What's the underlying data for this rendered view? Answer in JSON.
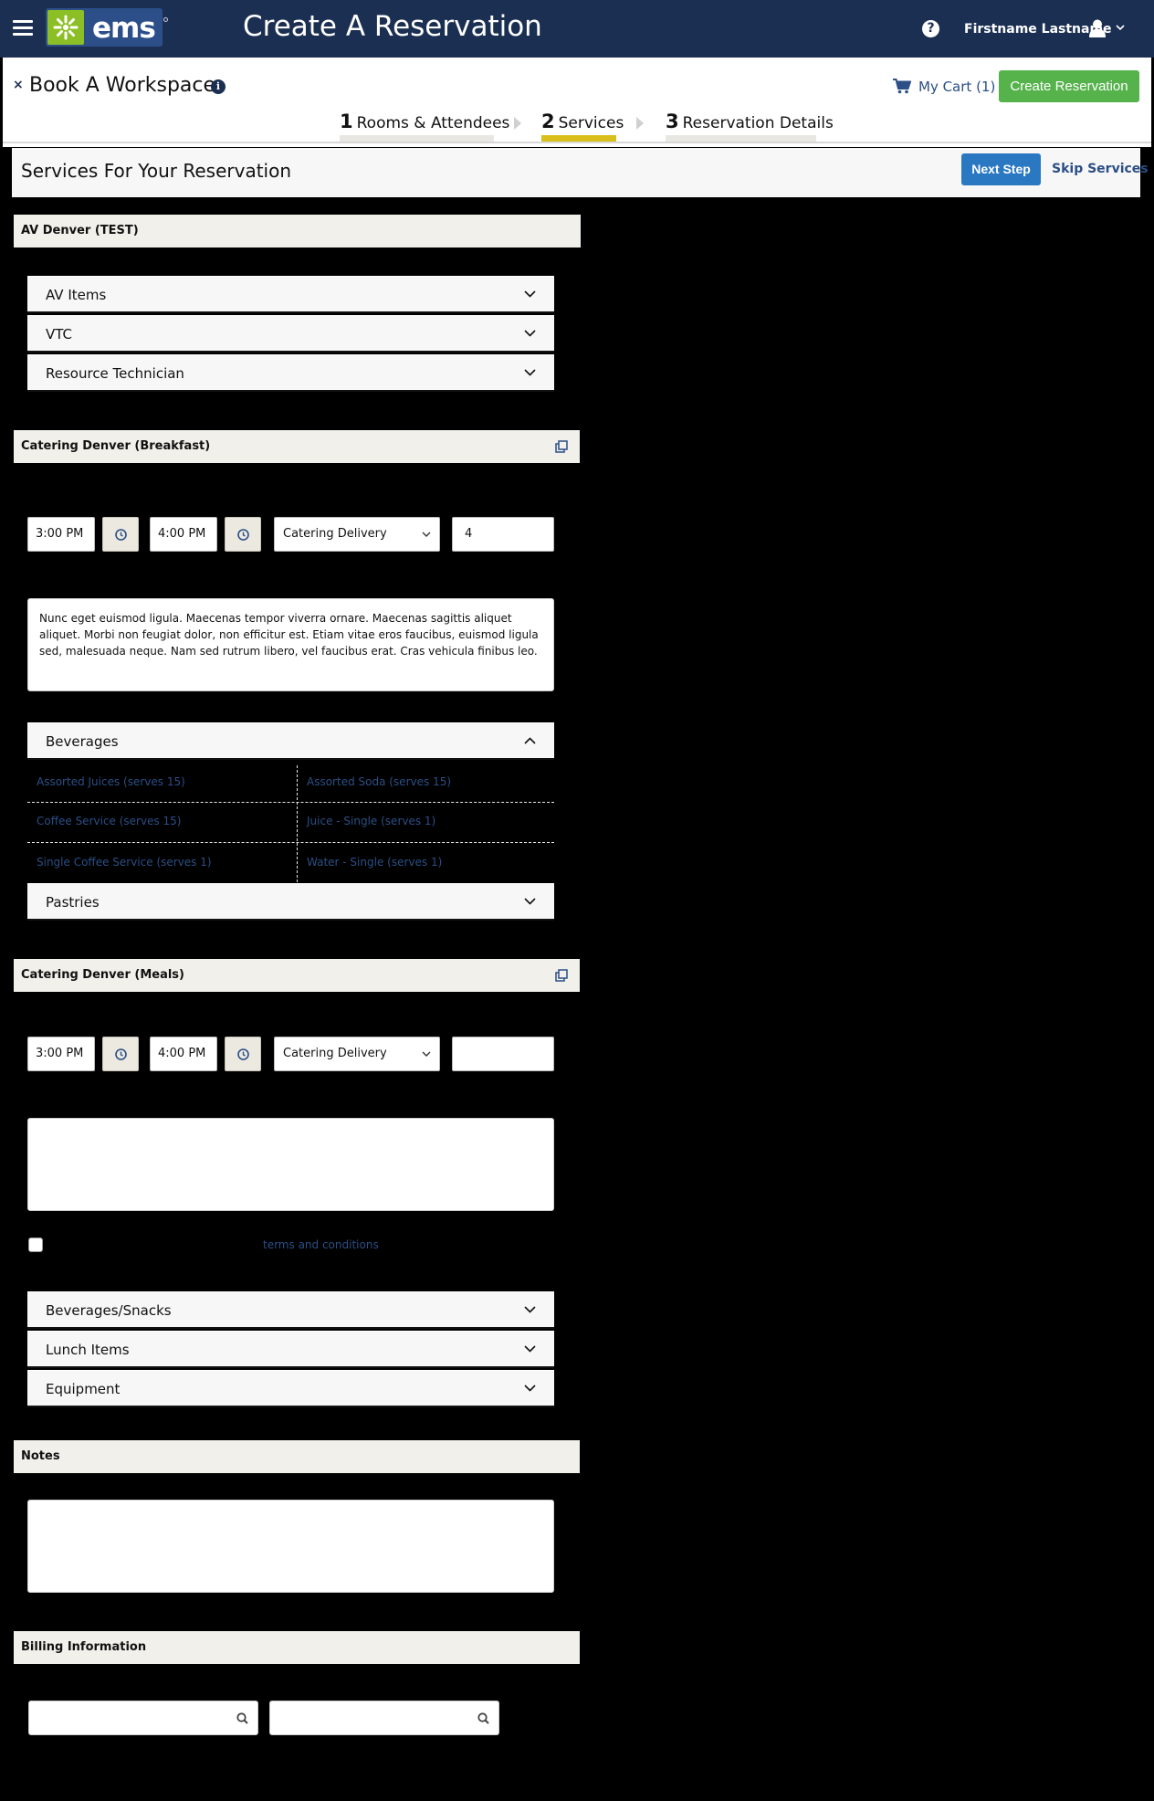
{
  "header": {
    "logo_text": "ems",
    "app_title": "Create A Reservation",
    "help_symbol": "?",
    "user_name": "Firstname Lastname"
  },
  "workspace": {
    "close_symbol": "×",
    "title": "Book A Workspace",
    "info_symbol": "i",
    "cart_label": "My Cart (1)",
    "create_button": "Create Reservation"
  },
  "steps": [
    {
      "number": "1",
      "label": "Rooms & Attendees",
      "active": false
    },
    {
      "number": "2",
      "label": "Services",
      "active": true
    },
    {
      "number": "3",
      "label": "Reservation Details",
      "active": false
    }
  ],
  "services": {
    "title": "Services For Your Reservation",
    "next_button": "Next Step",
    "skip_link": "Skip Services"
  },
  "av_section": {
    "title": "AV Denver (TEST)",
    "categories": [
      "AV Items",
      "VTC",
      "Resource Technician"
    ]
  },
  "breakfast_section": {
    "title": "Catering Denver (Breakfast)",
    "start_time": "3:00 PM",
    "end_time": "4:00 PM",
    "delivery": "Catering Delivery",
    "quantity": "4",
    "note": "Nunc eget euismod ligula. Maecenas tempor viverra ornare. Maecenas sagittis aliquet aliquet. Morbi non feugiat dolor, non efficitur est. Etiam vitae eros faucibus, euismod ligula sed, malesuada neque. Nam sed rutrum libero, vel faucibus erat. Cras vehicula finibus leo.",
    "beverages_label": "Beverages",
    "beverage_items": [
      "Assorted Juices (serves 15)",
      "Assorted Soda (serves 15)",
      "Coffee Service (serves 15)",
      "Juice - Single (serves 1)",
      "Single Coffee Service (serves 1)",
      "Water - Single (serves 1)"
    ],
    "pastries_label": "Pastries"
  },
  "meals_section": {
    "title": "Catering Denver (Meals)",
    "start_time": "3:00 PM",
    "end_time": "4:00 PM",
    "delivery": "Catering Delivery",
    "quantity": "",
    "note": "",
    "terms_link": "terms and conditions",
    "categories": [
      "Beverages/Snacks",
      "Lunch Items",
      "Equipment"
    ]
  },
  "notes_section": {
    "title": "Notes"
  },
  "billing_section": {
    "title": "Billing Information"
  },
  "colors": {
    "navy": "#1b2f52",
    "brand_green": "#8cbf26",
    "create_green": "#56b34c",
    "next_blue": "#2b78c2",
    "link_blue": "#2b4f86",
    "active_step": "#d9bf1b"
  }
}
